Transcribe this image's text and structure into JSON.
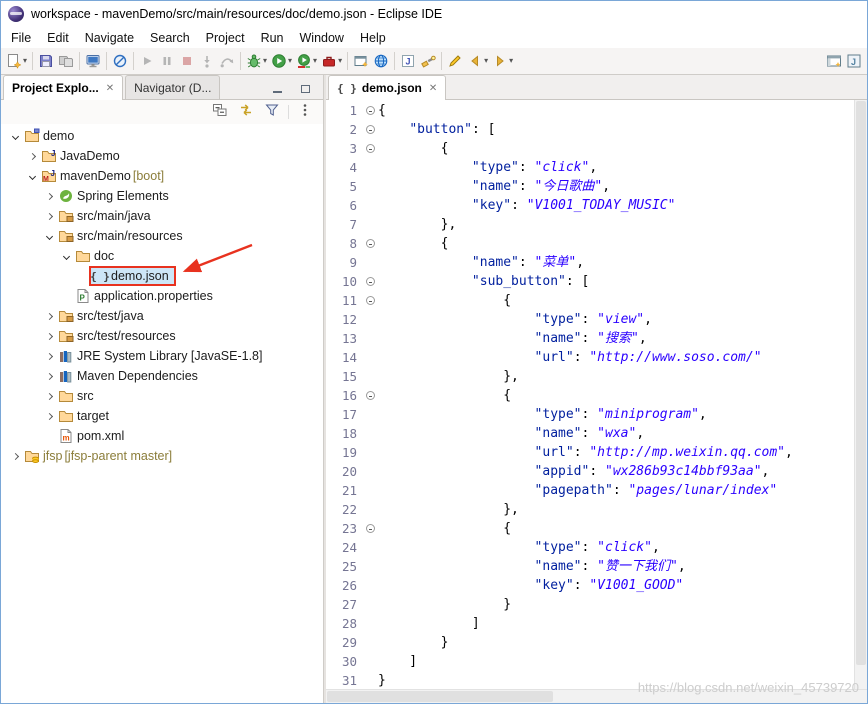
{
  "window": {
    "title": "workspace - mavenDemo/src/main/resources/doc/demo.json - Eclipse IDE"
  },
  "menubar": {
    "items": [
      "File",
      "Edit",
      "Navigate",
      "Search",
      "Project",
      "Run",
      "Window",
      "Help"
    ]
  },
  "toolbar": {
    "items": [
      {
        "name": "new",
        "dropdown": true
      },
      {
        "sep": true
      },
      {
        "name": "save"
      },
      {
        "name": "save-all"
      },
      {
        "sep": true
      },
      {
        "name": "print-console"
      },
      {
        "sep": true
      },
      {
        "name": "skip-all-breakpoints"
      },
      {
        "sep": true
      },
      {
        "name": "resume"
      },
      {
        "name": "suspend"
      },
      {
        "name": "terminate"
      },
      {
        "name": "step-into"
      },
      {
        "name": "step-over"
      },
      {
        "sep": true
      },
      {
        "name": "debug",
        "dropdown": true
      },
      {
        "name": "run",
        "dropdown": true
      },
      {
        "name": "coverage",
        "dropdown": true
      },
      {
        "name": "external-tools",
        "dropdown": true
      },
      {
        "sep": true
      },
      {
        "name": "new-java-project"
      },
      {
        "name": "new-web-project"
      },
      {
        "sep": true
      },
      {
        "name": "open-type"
      },
      {
        "name": "search"
      },
      {
        "sep": true
      },
      {
        "name": "last-edit-location"
      },
      {
        "name": "back",
        "dropdown": true
      },
      {
        "name": "forward",
        "dropdown": true
      },
      {
        "spacer": true
      },
      {
        "name": "open-perspective"
      },
      {
        "name": "java-perspective"
      }
    ]
  },
  "explorer": {
    "tabs": [
      {
        "label": "Project Explo...",
        "active": true,
        "closable": true
      },
      {
        "label": "Navigator (D...",
        "active": false,
        "closable": false
      }
    ],
    "window_buttons": [
      {
        "name": "minimize"
      },
      {
        "name": "maximize"
      }
    ],
    "view_toolbar": [
      {
        "name": "collapse-all"
      },
      {
        "name": "link-with-editor"
      },
      {
        "name": "filter"
      },
      {
        "sep": true
      },
      {
        "name": "view-menu"
      }
    ],
    "tree": [
      {
        "depth": 0,
        "arrow": "open",
        "icon": "project",
        "label": "demo"
      },
      {
        "depth": 1,
        "arrow": "closed",
        "icon": "java-project",
        "label": "JavaDemo"
      },
      {
        "depth": 1,
        "arrow": "open",
        "icon": "maven-project",
        "label": "mavenDemo",
        "decoration": " [boot]"
      },
      {
        "depth": 2,
        "arrow": "closed",
        "icon": "spring",
        "label": "Spring Elements"
      },
      {
        "depth": 2,
        "arrow": "closed",
        "icon": "source-folder",
        "label": "src/main/java"
      },
      {
        "depth": 2,
        "arrow": "open",
        "icon": "source-folder",
        "label": "src/main/resources"
      },
      {
        "depth": 3,
        "arrow": "open",
        "icon": "folder",
        "label": "doc"
      },
      {
        "depth": 4,
        "arrow": "none",
        "icon": "json-file",
        "label": "demo.json",
        "selected": true,
        "annotated": true
      },
      {
        "depth": 3,
        "arrow": "none",
        "icon": "properties-file",
        "label": "application.properties"
      },
      {
        "depth": 2,
        "arrow": "closed",
        "icon": "source-folder",
        "label": "src/test/java"
      },
      {
        "depth": 2,
        "arrow": "closed",
        "icon": "source-folder",
        "label": "src/test/resources"
      },
      {
        "depth": 2,
        "arrow": "closed",
        "icon": "library",
        "label": "JRE System Library [JavaSE-1.8]"
      },
      {
        "depth": 2,
        "arrow": "closed",
        "icon": "library",
        "label": "Maven Dependencies"
      },
      {
        "depth": 2,
        "arrow": "closed",
        "icon": "folder",
        "label": "src"
      },
      {
        "depth": 2,
        "arrow": "closed",
        "icon": "folder",
        "label": "target"
      },
      {
        "depth": 2,
        "arrow": "none",
        "icon": "xml-file",
        "label": "pom.xml"
      },
      {
        "depth": 0,
        "arrow": "closed",
        "icon": "git-project",
        "label": "jfsp",
        "decoration": " [jfsp-parent master]",
        "olive": true
      }
    ]
  },
  "editor": {
    "tab": {
      "icon": "json-file",
      "label": "demo.json",
      "close": "✕"
    },
    "lines": [
      {
        "n": 1,
        "fold": true,
        "parts": [
          [
            "p",
            "{"
          ]
        ]
      },
      {
        "n": 2,
        "fold": true,
        "parts": [
          [
            "p",
            "    "
          ],
          [
            "k",
            "\"button\""
          ],
          [
            "p",
            ": ["
          ]
        ]
      },
      {
        "n": 3,
        "fold": true,
        "parts": [
          [
            "p",
            "        {"
          ]
        ]
      },
      {
        "n": 4,
        "parts": [
          [
            "p",
            "            "
          ],
          [
            "k",
            "\"type\""
          ],
          [
            "p",
            ": "
          ],
          [
            "v",
            "\"click\""
          ],
          [
            "p",
            ","
          ]
        ]
      },
      {
        "n": 5,
        "parts": [
          [
            "p",
            "            "
          ],
          [
            "k",
            "\"name\""
          ],
          [
            "p",
            ": "
          ],
          [
            "v",
            "\"今日歌曲\""
          ],
          [
            "p",
            ","
          ]
        ]
      },
      {
        "n": 6,
        "parts": [
          [
            "p",
            "            "
          ],
          [
            "k",
            "\"key\""
          ],
          [
            "p",
            ": "
          ],
          [
            "v",
            "\"V1001_TODAY_MUSIC\""
          ]
        ]
      },
      {
        "n": 7,
        "parts": [
          [
            "p",
            "        },"
          ]
        ]
      },
      {
        "n": 8,
        "fold": true,
        "parts": [
          [
            "p",
            "        {"
          ]
        ]
      },
      {
        "n": 9,
        "parts": [
          [
            "p",
            "            "
          ],
          [
            "k",
            "\"name\""
          ],
          [
            "p",
            ": "
          ],
          [
            "v",
            "\"菜单\""
          ],
          [
            "p",
            ","
          ]
        ]
      },
      {
        "n": 10,
        "fold": true,
        "parts": [
          [
            "p",
            "            "
          ],
          [
            "k",
            "\"sub_button\""
          ],
          [
            "p",
            ": ["
          ]
        ]
      },
      {
        "n": 11,
        "fold": true,
        "parts": [
          [
            "p",
            "                {"
          ]
        ]
      },
      {
        "n": 12,
        "parts": [
          [
            "p",
            "                    "
          ],
          [
            "k",
            "\"type\""
          ],
          [
            "p",
            ": "
          ],
          [
            "v",
            "\"view\""
          ],
          [
            "p",
            ","
          ]
        ]
      },
      {
        "n": 13,
        "parts": [
          [
            "p",
            "                    "
          ],
          [
            "k",
            "\"name\""
          ],
          [
            "p",
            ": "
          ],
          [
            "v",
            "\"搜索\""
          ],
          [
            "p",
            ","
          ]
        ]
      },
      {
        "n": 14,
        "parts": [
          [
            "p",
            "                    "
          ],
          [
            "k",
            "\"url\""
          ],
          [
            "p",
            ": "
          ],
          [
            "v",
            "\"http://www.soso.com/\""
          ]
        ]
      },
      {
        "n": 15,
        "parts": [
          [
            "p",
            "                },"
          ]
        ]
      },
      {
        "n": 16,
        "fold": true,
        "parts": [
          [
            "p",
            "                {"
          ]
        ]
      },
      {
        "n": 17,
        "parts": [
          [
            "p",
            "                    "
          ],
          [
            "k",
            "\"type\""
          ],
          [
            "p",
            ": "
          ],
          [
            "v",
            "\"miniprogram\""
          ],
          [
            "p",
            ","
          ]
        ]
      },
      {
        "n": 18,
        "parts": [
          [
            "p",
            "                    "
          ],
          [
            "k",
            "\"name\""
          ],
          [
            "p",
            ": "
          ],
          [
            "v",
            "\"wxa\""
          ],
          [
            "p",
            ","
          ]
        ]
      },
      {
        "n": 19,
        "parts": [
          [
            "p",
            "                    "
          ],
          [
            "k",
            "\"url\""
          ],
          [
            "p",
            ": "
          ],
          [
            "v",
            "\"http://mp.weixin.qq.com\""
          ],
          [
            "p",
            ","
          ]
        ]
      },
      {
        "n": 20,
        "parts": [
          [
            "p",
            "                    "
          ],
          [
            "k",
            "\"appid\""
          ],
          [
            "p",
            ": "
          ],
          [
            "v",
            "\"wx286b93c14bbf93aa\""
          ],
          [
            "p",
            ","
          ]
        ]
      },
      {
        "n": 21,
        "parts": [
          [
            "p",
            "                    "
          ],
          [
            "k",
            "\"pagepath\""
          ],
          [
            "p",
            ": "
          ],
          [
            "v",
            "\"pages/lunar/index\""
          ]
        ]
      },
      {
        "n": 22,
        "parts": [
          [
            "p",
            "                },"
          ]
        ]
      },
      {
        "n": 23,
        "fold": true,
        "parts": [
          [
            "p",
            "                {"
          ]
        ]
      },
      {
        "n": 24,
        "parts": [
          [
            "p",
            "                    "
          ],
          [
            "k",
            "\"type\""
          ],
          [
            "p",
            ": "
          ],
          [
            "v",
            "\"click\""
          ],
          [
            "p",
            ","
          ]
        ]
      },
      {
        "n": 25,
        "parts": [
          [
            "p",
            "                    "
          ],
          [
            "k",
            "\"name\""
          ],
          [
            "p",
            ": "
          ],
          [
            "v",
            "\"赞一下我们\""
          ],
          [
            "p",
            ","
          ]
        ]
      },
      {
        "n": 26,
        "parts": [
          [
            "p",
            "                    "
          ],
          [
            "k",
            "\"key\""
          ],
          [
            "p",
            ": "
          ],
          [
            "v",
            "\"V1001_GOOD\""
          ]
        ]
      },
      {
        "n": 27,
        "parts": [
          [
            "p",
            "                }"
          ]
        ]
      },
      {
        "n": 28,
        "parts": [
          [
            "p",
            "            ]"
          ]
        ]
      },
      {
        "n": 29,
        "parts": [
          [
            "p",
            "        }"
          ]
        ]
      },
      {
        "n": 30,
        "parts": [
          [
            "p",
            "    ]"
          ]
        ]
      },
      {
        "n": 31,
        "parts": [
          [
            "p",
            "}"
          ]
        ]
      }
    ]
  },
  "watermark": "https://blog.csdn.net/weixin_45739720",
  "colors": {
    "json_key": "#001F9E",
    "json_value": "#2A00FF",
    "json_punct": "#000000",
    "line_number": "#757593",
    "tree_selection": "#CDE6F7",
    "annotation_red": "#E8321F",
    "decoration_olive": "#8B7D3A",
    "window_border": "#7AA7D7"
  }
}
